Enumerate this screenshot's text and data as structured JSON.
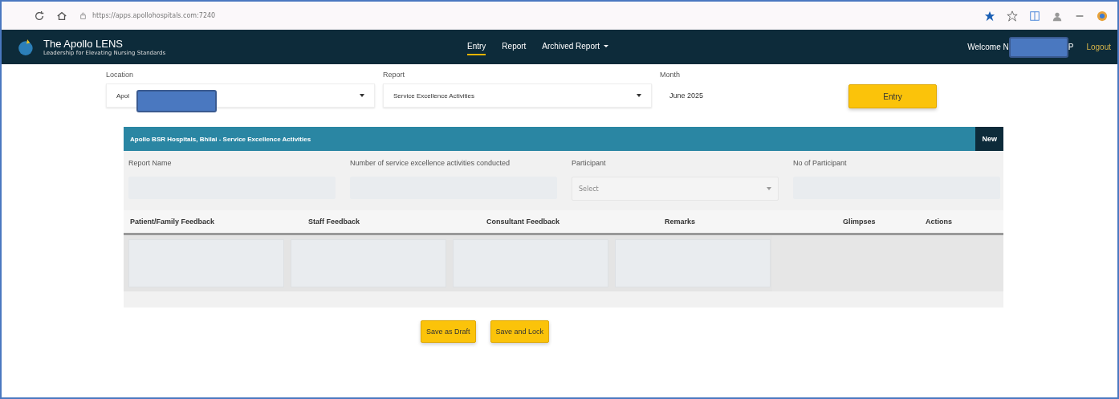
{
  "browser": {
    "url": "https://apps.apollohospitals.com:7240"
  },
  "nav": {
    "brand": "The Apollo LENS",
    "tagline": "Leadership for Elevating Nursing Standards",
    "links": [
      {
        "label": "Entry",
        "selected": true,
        "dropdown": false
      },
      {
        "label": "Report",
        "selected": false,
        "dropdown": false
      },
      {
        "label": "Archived Report",
        "selected": false,
        "dropdown": true
      }
    ],
    "welcome": "Welcome N",
    "welcome_tail": "P",
    "logout": "Logout"
  },
  "filters": {
    "location": {
      "label": "Location",
      "value": "Apol"
    },
    "report": {
      "label": "Report",
      "value": "Service Excellence Activities"
    },
    "month": {
      "label": "Month",
      "value": "June 2025"
    },
    "button": "Entry"
  },
  "panel": {
    "title": "Apollo BSR Hospitals, Bhilai - Service Excellence Activities",
    "badge": "New",
    "fields": [
      {
        "label": "Report Name",
        "kind": "text"
      },
      {
        "label": "Number of service excellence activities conducted",
        "kind": "text"
      },
      {
        "label": "Participant",
        "kind": "select",
        "placeholder": "Select"
      },
      {
        "label": "No of Participant",
        "kind": "text"
      }
    ],
    "table": {
      "columns": [
        {
          "label": "Patient/Family Feedback",
          "kind": "textarea"
        },
        {
          "label": "Staff Feedback",
          "kind": "textarea"
        },
        {
          "label": "Consultant Feedback",
          "kind": "textarea"
        },
        {
          "label": "Remarks",
          "kind": "textarea"
        },
        {
          "label": "Glimpses",
          "kind": "empty"
        },
        {
          "label": "Actions",
          "kind": "empty"
        }
      ]
    }
  },
  "buttons": [
    "Save as Draft",
    "Save and Lock"
  ]
}
